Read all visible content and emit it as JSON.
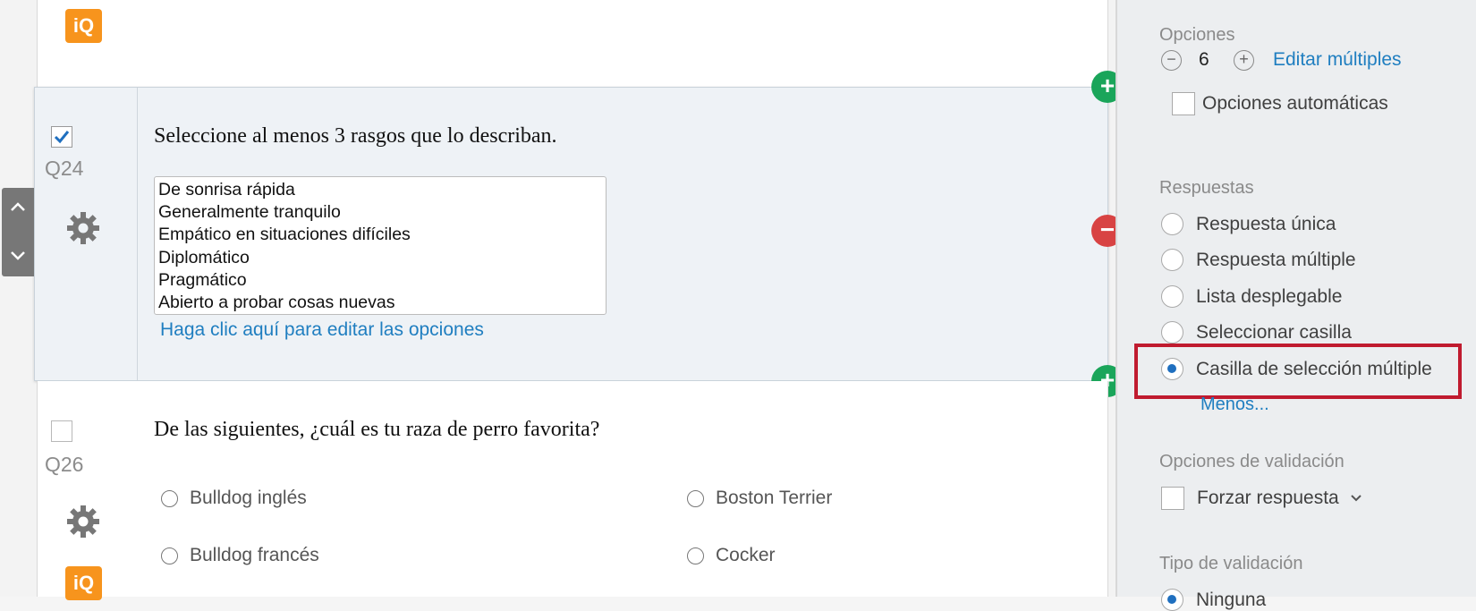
{
  "brand": {
    "iq_label": "iQ",
    "accent": "#f7941d"
  },
  "question_active": {
    "id": "Q24",
    "checked": true,
    "text": "Seleccione al menos 3 rasgos que lo describan.",
    "choices": [
      "De sonrisa rápida",
      "Generalmente tranquilo",
      "Empático en situaciones difíciles",
      "Diplomático",
      "Pragmático",
      "Abierto a probar cosas nuevas"
    ],
    "edit_link": "Haga clic aquí para editar las opciones"
  },
  "question_next": {
    "id": "Q26",
    "checked": false,
    "text": "De las siguientes, ¿cuál es tu raza de perro favorita?",
    "options": [
      "Bulldog inglés",
      "Boston Terrier",
      "Bulldog francés",
      "Cocker"
    ]
  },
  "buttons": {
    "add": "+",
    "remove": "−"
  },
  "panel": {
    "options_heading": "Opciones",
    "options_count": "6",
    "minus_symbol": "−",
    "plus_symbol": "+",
    "edit_multiple": "Editar múltiples",
    "auto_options": "Opciones automáticas",
    "answers_heading": "Respuestas",
    "answers": [
      {
        "label": "Respuesta única",
        "selected": false
      },
      {
        "label": "Respuesta múltiple",
        "selected": false
      },
      {
        "label": "Lista desplegable",
        "selected": false
      },
      {
        "label": "Seleccionar casilla",
        "selected": false
      },
      {
        "label": "Casilla de selección múltiple",
        "selected": true
      }
    ],
    "less_link": "Menos...",
    "validation_heading": "Opciones de validación",
    "force_response": "Forzar respuesta",
    "validation_type_heading": "Tipo de validación",
    "validation_type_first": "Ninguna"
  },
  "colors": {
    "highlight": "#c01b2f",
    "link": "#1f7ec0",
    "green": "#1aa55a",
    "red": "#d84343"
  }
}
